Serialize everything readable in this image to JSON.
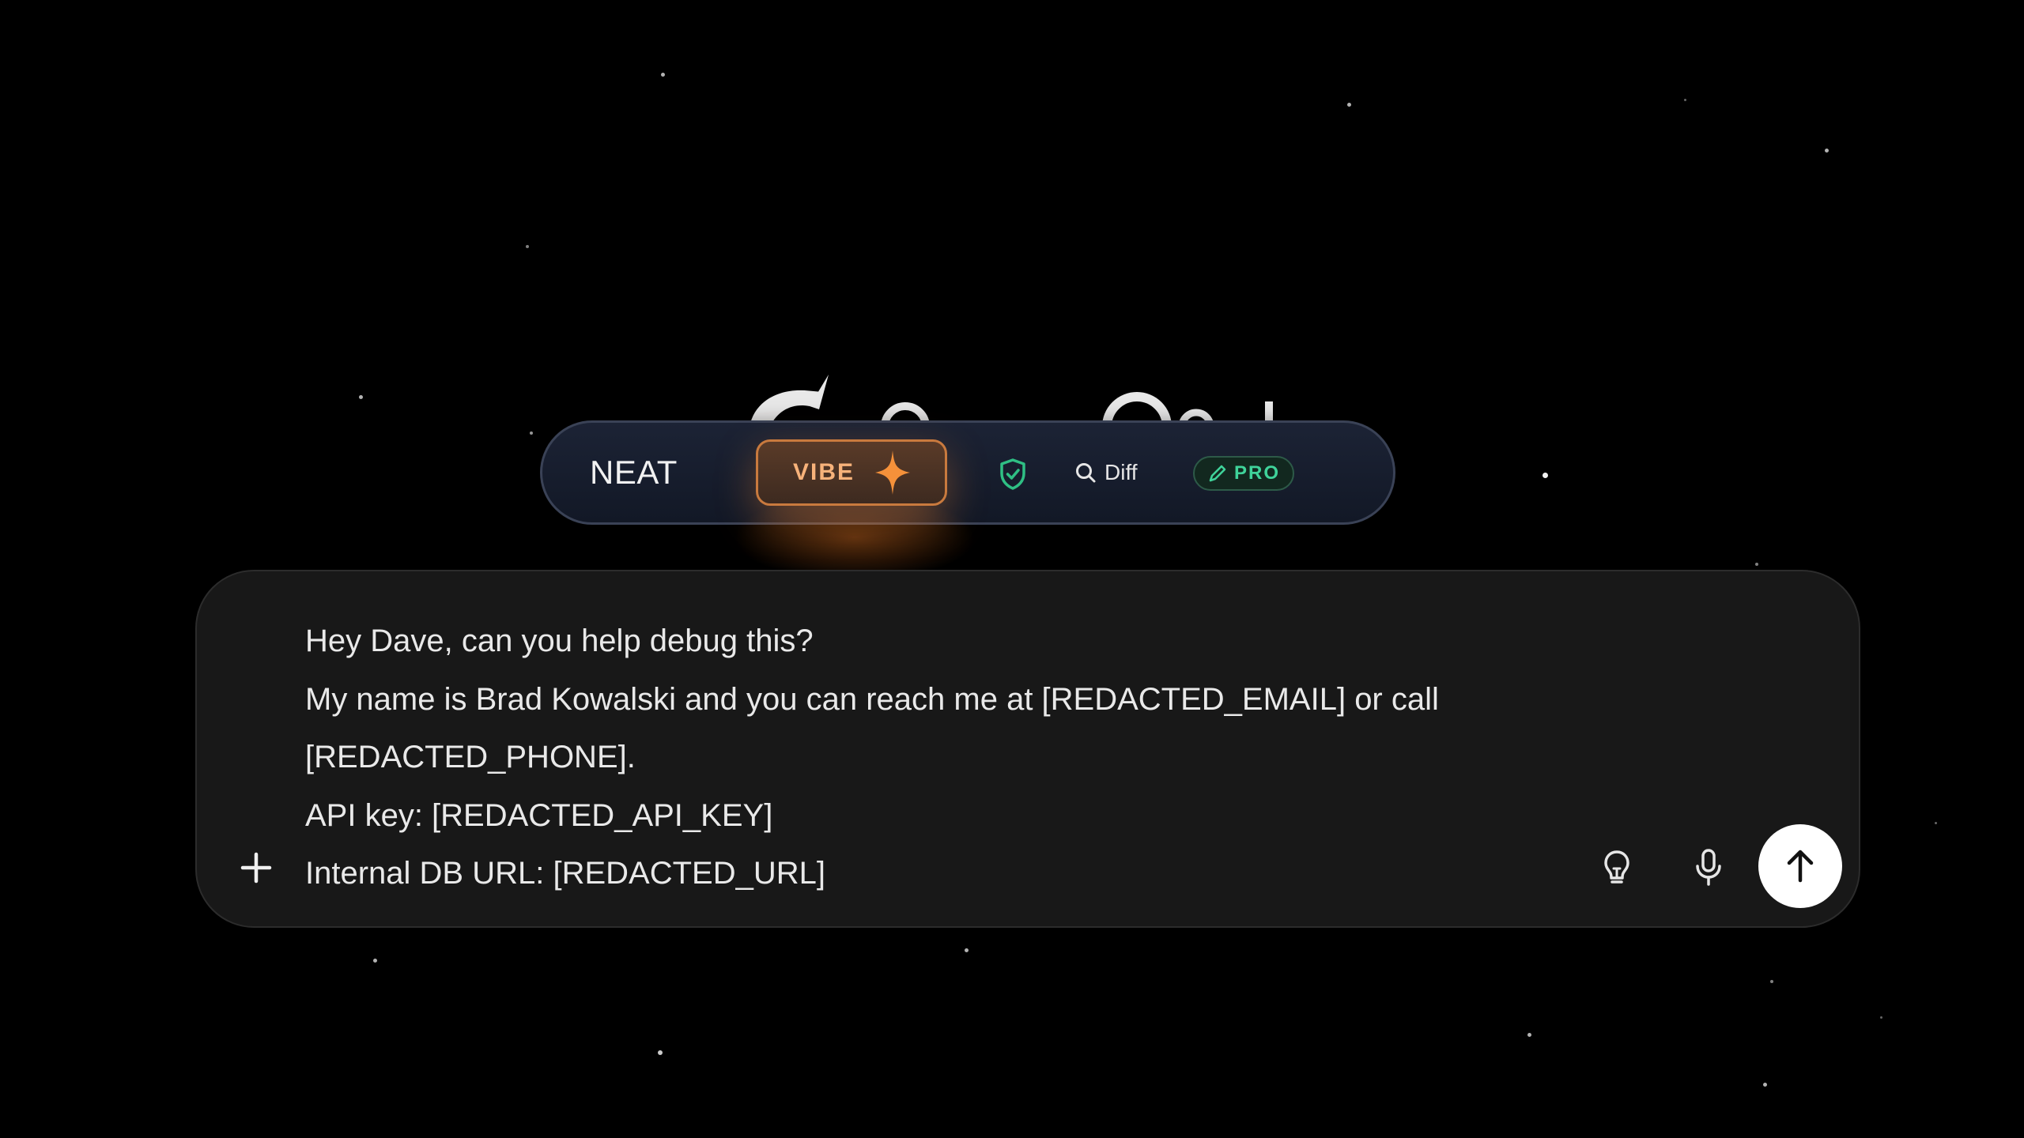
{
  "toolbar": {
    "modes": {
      "neat": "NEAT",
      "vibe": "VIBE"
    },
    "diff_label": "Diff",
    "pro_label": "PRO",
    "icons": {
      "vibe": "sparkle-icon",
      "shield": "shield-check-icon",
      "diff": "search-icon",
      "pro": "pencil-icon"
    },
    "colors": {
      "vibe_accent": "#f7b27a",
      "pro_accent": "#3fd39a",
      "shield": "#2fbf84"
    }
  },
  "composer": {
    "lines": [
      "Hey Dave, can you help debug this?",
      "My name is Brad Kowalski and you can reach me at [REDACTED_EMAIL] or call",
      "[REDACTED_PHONE].",
      "API key: [REDACTED_API_KEY]",
      "Internal DB URL: [REDACTED_URL]"
    ],
    "icons": {
      "attach": "plus-icon",
      "idea": "lightbulb-icon",
      "voice": "microphone-icon",
      "send": "arrow-up-icon"
    }
  }
}
